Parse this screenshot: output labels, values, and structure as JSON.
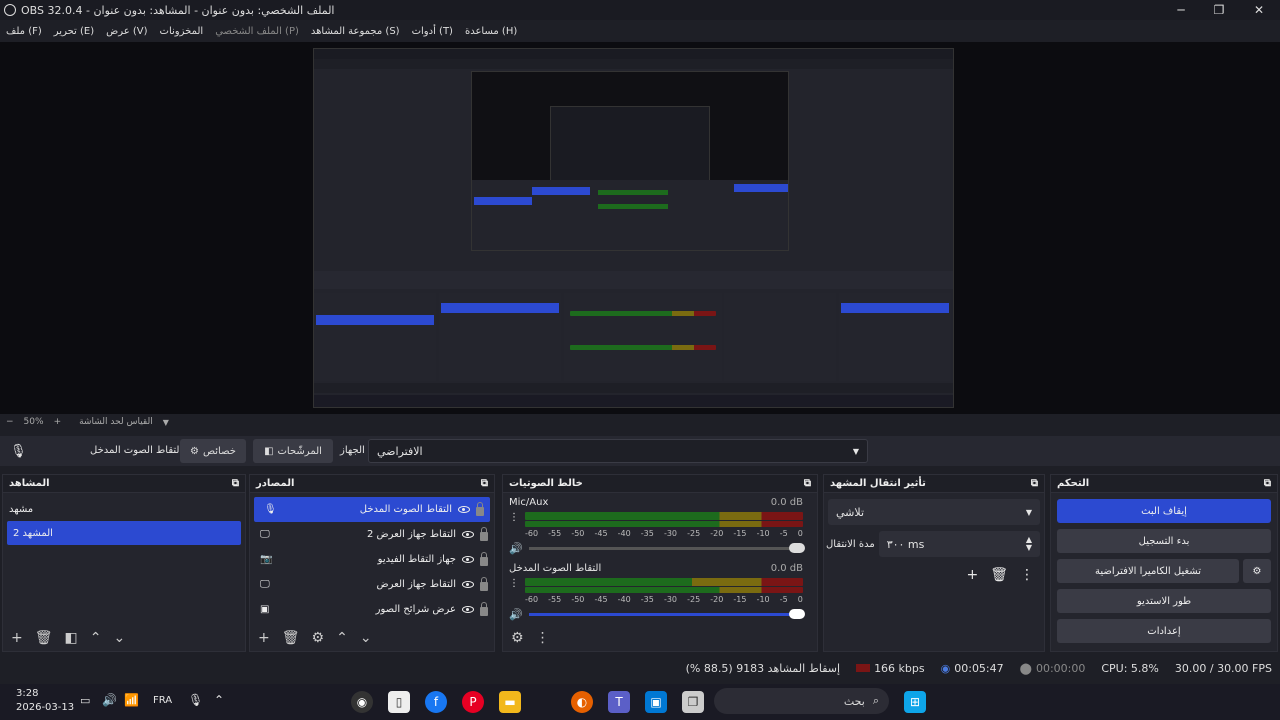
{
  "window": {
    "title": "OBS 32.0.4 - الملف الشخصي: بدون عنوان - المشاهد: بدون عنوان",
    "minimize_glyph": "─",
    "maximize_glyph": "❐",
    "close_glyph": "✕"
  },
  "menu": [
    "ملف (F)",
    "تحرير (E)",
    "عرض (V)",
    "المخزونات",
    "الملف الشخصي (P)",
    "مجموعة المشاهد (S)",
    "أدوات (T)",
    "مساعدة (H)"
  ],
  "preview_toolbar": {
    "zoom": "50%",
    "fit_label": "القياس لحد الشاشة",
    "minus": "−",
    "plus": "+"
  },
  "source_toolbar": {
    "source_name": "التقاط الصوت المدخل",
    "properties_label": "خصائص",
    "filters_label": "المرشّحات",
    "device_label": "الجهاز",
    "device_value": "الافتراضي"
  },
  "docks": {
    "scenes": {
      "title": "المشاهد",
      "items": [
        "مشهد",
        "المشهد 2"
      ],
      "selected_index": 1
    },
    "sources": {
      "title": "المصادر",
      "items": [
        {
          "label": "التقاط الصوت المدخل",
          "icon": "mic-icon"
        },
        {
          "label": "التقاط جهاز العرض 2",
          "icon": "monitor-icon"
        },
        {
          "label": "جهاز التقاط الفيديو",
          "icon": "camera-icon"
        },
        {
          "label": "التقاط جهاز العرض",
          "icon": "monitor-icon"
        },
        {
          "label": "عرض شرائح الصور",
          "icon": "slideshow-icon"
        }
      ],
      "selected_index": 0
    },
    "mixer": {
      "title": "خالط الصوتيات",
      "channels": [
        {
          "name": "Mic/Aux",
          "db": "0.0 dB",
          "volume": 1.0
        },
        {
          "name": "التقاط الصوت المدخل",
          "db": "0.0 dB",
          "volume": 1.0
        }
      ],
      "ticks": [
        "-60",
        "-55",
        "-50",
        "-45",
        "-40",
        "-35",
        "-30",
        "-25",
        "-20",
        "-15",
        "-10",
        "-5",
        "0"
      ]
    },
    "transitions": {
      "title": "تأثير انتقال المشهد",
      "transition": "تلاشي",
      "duration_label": "مدة الانتقال",
      "duration_value": "٣٠٠ ms"
    },
    "controls": {
      "title": "التحكم",
      "buttons": [
        "إيقاف البث",
        "بدء التسجيل",
        "تشغيل الكاميرا الافتراضية",
        "طور الاستديو",
        "إعدادات"
      ]
    }
  },
  "status": {
    "dropped_frames": "إسقاط المشاهد 9183 (88.5 %)",
    "bitrate": "166 kbps",
    "stream_time": "00:05:47",
    "record_time": "00:00:00",
    "cpu": "CPU: 5.8%",
    "fps": "30.00 / 30.00 FPS"
  },
  "taskbar": {
    "time": "3:28",
    "date": "2026-03-13",
    "language": "FRA",
    "search_placeholder": "بحث"
  },
  "colors": {
    "accent": "#2c4ad1",
    "background": "#1e1f26",
    "panel": "#24252d"
  }
}
